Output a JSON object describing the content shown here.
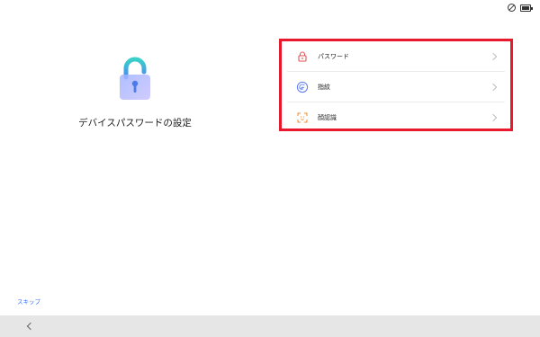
{
  "status_bar": {
    "icons": [
      "do-not-disturb-icon",
      "battery-icon"
    ]
  },
  "left": {
    "title": "デバイスパスワードの設定",
    "illustration": "padlock-icon"
  },
  "options": [
    {
      "label": "パスワード",
      "icon": "lock-icon",
      "color": "#e25656"
    },
    {
      "label": "指紋",
      "icon": "fingerprint-icon",
      "color": "#5c7cf0"
    },
    {
      "label": "顔認識",
      "icon": "face-scan-icon",
      "color": "#f08a2a"
    }
  ],
  "highlight_color": "#e8192c",
  "skip_label": "スキップ",
  "nav": {
    "back_icon": "chevron-left-icon"
  }
}
